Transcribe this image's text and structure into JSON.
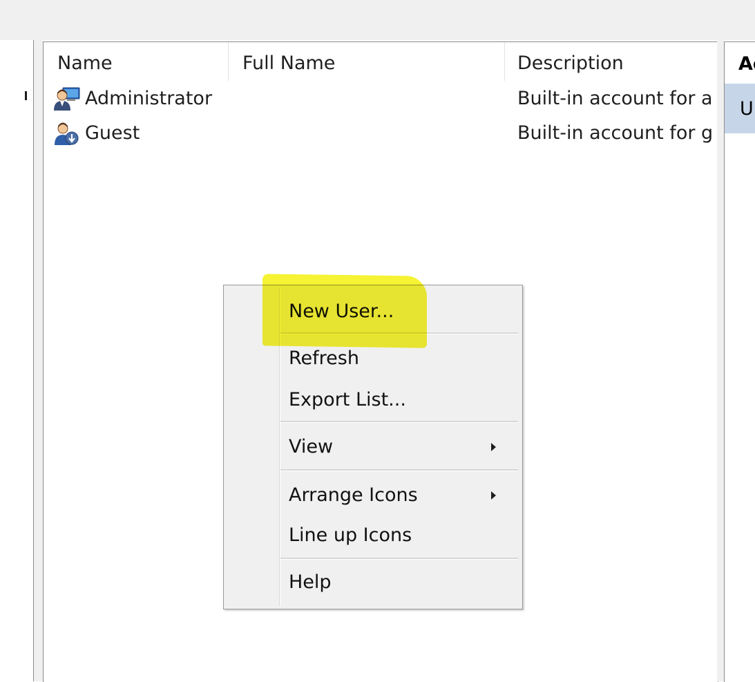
{
  "columns": {
    "name": "Name",
    "full_name": "Full Name",
    "description": "Description"
  },
  "users": [
    {
      "name": "Administrator",
      "full_name": "",
      "description": "Built-in account for a",
      "icon": "admin-user-icon"
    },
    {
      "name": "Guest",
      "full_name": "",
      "description": "Built-in account for g",
      "icon": "guest-user-icon"
    }
  ],
  "actions": {
    "header": "Ac",
    "item": "U"
  },
  "context_menu": {
    "new_user": "New User...",
    "refresh": "Refresh",
    "export_list": "Export List...",
    "view": "View",
    "arrange_icons": "Arrange Icons",
    "line_up_icons": "Line up Icons",
    "help": "Help"
  },
  "colors": {
    "highlight": "#f4f21c",
    "menu_background": "#f0f0f0",
    "action_selected": "#c6d6e8"
  }
}
